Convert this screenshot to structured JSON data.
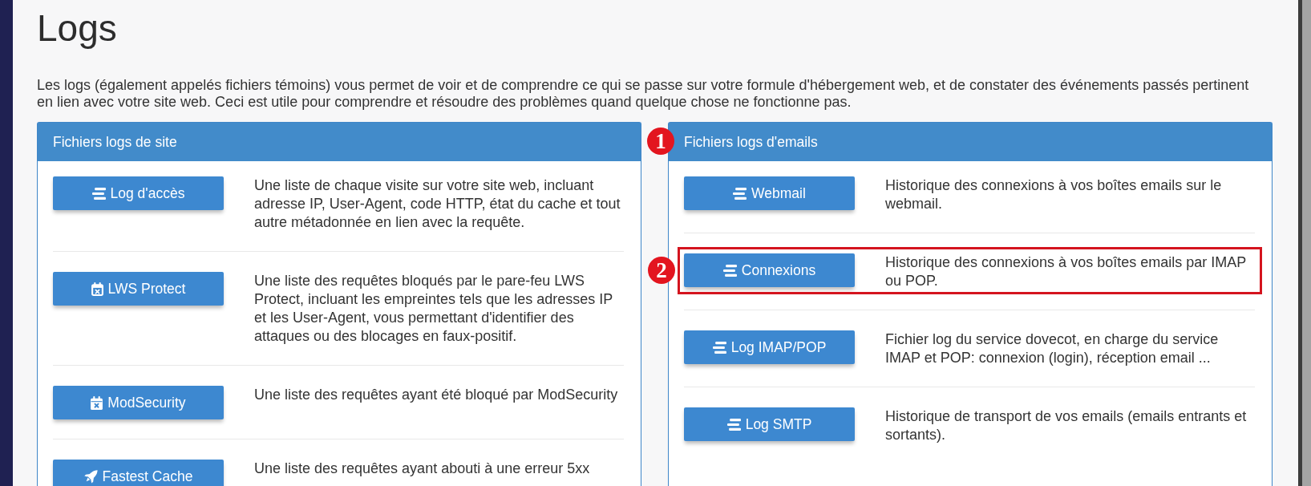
{
  "page": {
    "title": "Logs",
    "intro": "Les logs (également appelés fichiers témoins) vous permet de voir et de comprendre ce qui se passe sur votre formule d'hébergement web, et de constater des événements passés pertinent en lien avec votre site web. Ceci est utile pour comprendre et résoudre des problèmes quand quelque chose ne fonctionne pas."
  },
  "panels": [
    {
      "title": "Fichiers logs de site",
      "rows": [
        {
          "label": "Log d'accès",
          "description": "Une liste de chaque visite sur votre site web, incluant adresse IP, User-Agent, code HTTP, état du cache et tout autre métadonnée en lien avec la requête.",
          "highlighted": false
        },
        {
          "label": "LWS Protect",
          "description": "Une liste des requêtes bloqués par le pare-feu LWS Protect, incluant les empreintes tels que les adresses IP et les User-Agent, vous permettant d'identifier des attaques ou des blocages en faux-positif.",
          "highlighted": false
        },
        {
          "label": "ModSecurity",
          "description": "Une liste des requêtes ayant été bloqué par ModSecurity",
          "highlighted": false
        },
        {
          "label": "Fastest Cache",
          "description": "Une liste des requêtes ayant abouti à une erreur 5xx",
          "highlighted": false
        }
      ]
    },
    {
      "title": "Fichiers logs d'emails",
      "callout": "1",
      "rows": [
        {
          "label": "Webmail",
          "description": "Historique des connexions à vos boîtes emails sur le webmail.",
          "highlighted": false
        },
        {
          "label": "Connexions",
          "description": "Historique des connexions à vos boîtes emails par IMAP ou POP.",
          "highlighted": true,
          "callout": "2"
        },
        {
          "label": "Log IMAP/POP",
          "description": "Fichier log du service dovecot, en charge du service IMAP et POP: connexion (login), réception email ...",
          "highlighted": false
        },
        {
          "label": "Log SMTP",
          "description": "Historique de transport de vos emails (emails entrants et sortants).",
          "highlighted": false
        }
      ]
    }
  ]
}
